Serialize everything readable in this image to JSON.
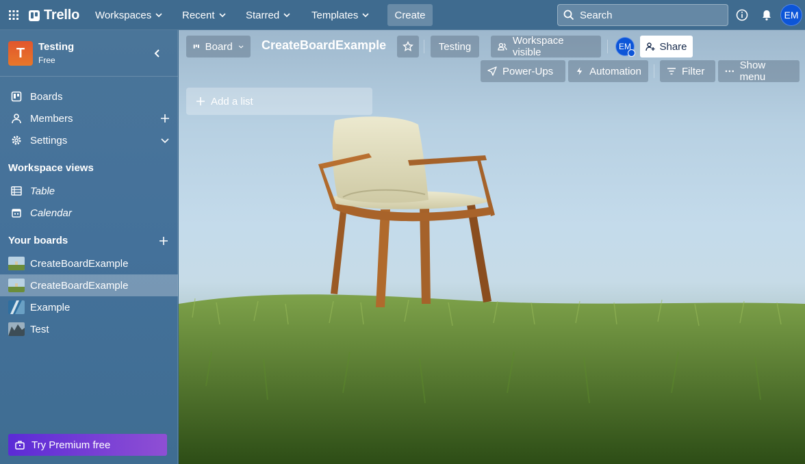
{
  "topbar": {
    "logo_text": "Trello",
    "nav": [
      "Workspaces",
      "Recent",
      "Starred",
      "Templates"
    ],
    "create_label": "Create",
    "search_placeholder": "Search",
    "user_initials": "EM"
  },
  "sidebar": {
    "workspace_initial": "T",
    "workspace_name": "Testing",
    "workspace_plan": "Free",
    "items": [
      {
        "label": "Boards",
        "icon": "board-icon"
      },
      {
        "label": "Members",
        "icon": "person-icon"
      },
      {
        "label": "Settings",
        "icon": "gear-icon"
      }
    ],
    "views_heading": "Workspace views",
    "views": [
      {
        "label": "Table",
        "icon": "table-icon"
      },
      {
        "label": "Calendar",
        "icon": "calendar-icon"
      }
    ],
    "boards_heading": "Your boards",
    "boards": [
      {
        "label": "CreateBoardExample",
        "active": false
      },
      {
        "label": "CreateBoardExample",
        "active": true
      },
      {
        "label": "Example",
        "active": false
      },
      {
        "label": "Test",
        "active": false
      }
    ],
    "premium_label": "Try Premium free"
  },
  "board": {
    "view_label": "Board",
    "title": "CreateBoardExample",
    "workspace_label": "Testing",
    "visibility_label": "Workspace visible",
    "member_initials": "EM",
    "share_label": "Share",
    "powerups_label": "Power-Ups",
    "automation_label": "Automation",
    "filter_label": "Filter",
    "menu_label": "Show menu",
    "add_list_label": "Add a list"
  },
  "colors": {
    "topbar": "#3f6b8f",
    "sidebar": "#44719a",
    "avatar": "#0c55d8",
    "workspace_tile": "#e2562c",
    "premium": "#8f4fd4"
  }
}
